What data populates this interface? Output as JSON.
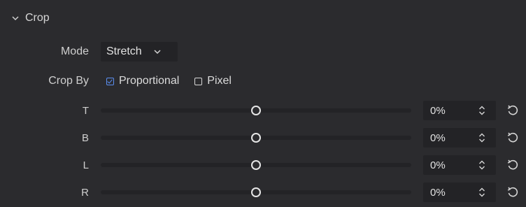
{
  "section": {
    "title": "Crop",
    "expanded": true
  },
  "mode": {
    "label": "Mode",
    "value": "Stretch"
  },
  "crop_by": {
    "label": "Crop By",
    "options": [
      {
        "label": "Proportional",
        "checked": true
      },
      {
        "label": "Pixel",
        "checked": false
      }
    ]
  },
  "sliders": [
    {
      "label": "T",
      "value": "0%",
      "level": 0.5
    },
    {
      "label": "B",
      "value": "0%",
      "level": 0.5
    },
    {
      "label": "L",
      "value": "0%",
      "level": 0.5
    },
    {
      "label": "R",
      "value": "0%",
      "level": 0.5
    }
  ],
  "colors": {
    "background": "#2b2b2e",
    "field": "#232326",
    "accent": "#5b8ff2",
    "text": "#d8d8d8"
  },
  "icons": {
    "section_toggle": "chevron-down-icon",
    "dropdown": "chevron-down-icon",
    "spinner": "up-down-arrows-icon",
    "reset": "reset-icon"
  }
}
